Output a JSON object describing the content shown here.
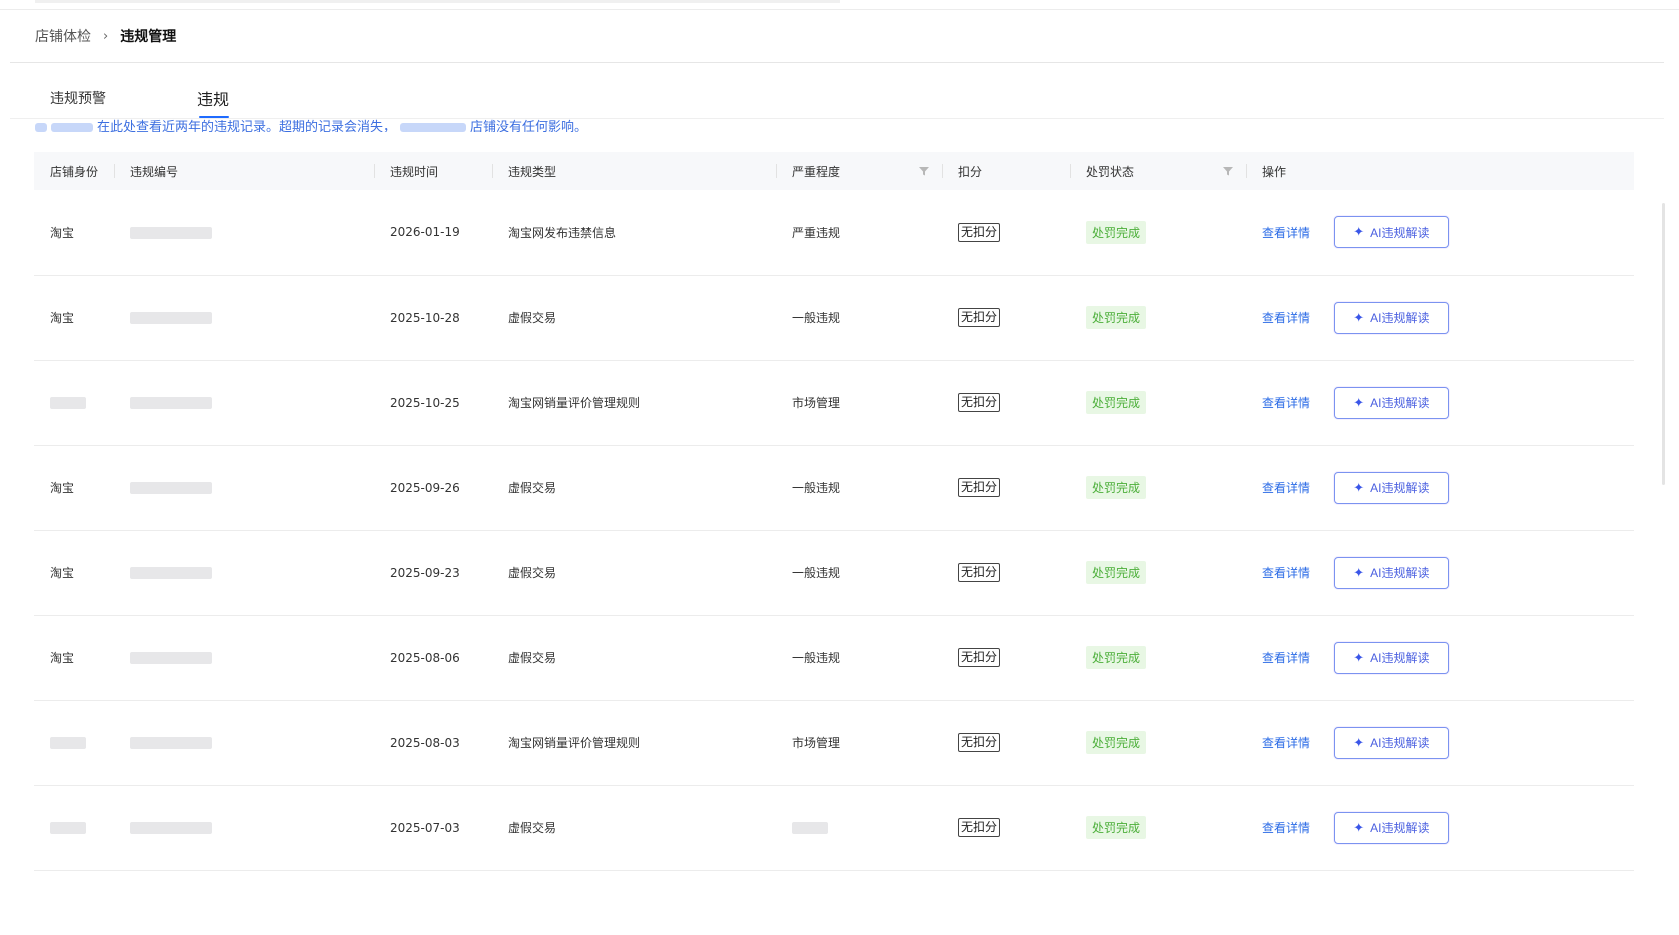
{
  "breadcrumb": {
    "parent": "店铺体检",
    "separator": "›",
    "current": "违规管理"
  },
  "tabs": {
    "warning": "违规预警",
    "violation": "违规"
  },
  "notice": {
    "text_a": "在此处查看近两年的违规记录。超期的记录会消失，",
    "text_b": "店铺没有任何影响。"
  },
  "columns": {
    "shop_identity": "店铺身份",
    "violation_id": "违规编号",
    "violation_time": "违规时间",
    "violation_type": "违规类型",
    "severity": "严重程度",
    "deduction": "扣分",
    "penalty_status": "处罚状态",
    "action": "操作"
  },
  "rows": [
    {
      "shop": "淘宝",
      "id": "",
      "date": "2026-01-19",
      "type": "淘宝网发布违禁信息",
      "severity": "严重违规",
      "deduction": "无扣分",
      "status": "处罚完成",
      "detail": "查看详情",
      "ai": "AI违规解读"
    },
    {
      "shop": "淘宝",
      "id": "",
      "date": "2025-10-28",
      "type": "虚假交易",
      "severity": "一般违规",
      "deduction": "无扣分",
      "status": "处罚完成",
      "detail": "查看详情",
      "ai": "AI违规解读"
    },
    {
      "shop": "",
      "id": "",
      "date": "2025-10-25",
      "type": "淘宝网销量评价管理规则",
      "severity": "市场管理",
      "deduction": "无扣分",
      "status": "处罚完成",
      "detail": "查看详情",
      "ai": "AI违规解读"
    },
    {
      "shop": "淘宝",
      "id": "",
      "date": "2025-09-26",
      "type": "虚假交易",
      "severity": "一般违规",
      "deduction": "无扣分",
      "status": "处罚完成",
      "detail": "查看详情",
      "ai": "AI违规解读"
    },
    {
      "shop": "淘宝",
      "id": "",
      "date": "2025-09-23",
      "type": "虚假交易",
      "severity": "一般违规",
      "deduction": "无扣分",
      "status": "处罚完成",
      "detail": "查看详情",
      "ai": "AI违规解读"
    },
    {
      "shop": "淘宝",
      "id": "",
      "date": "2025-08-06",
      "type": "虚假交易",
      "severity": "一般违规",
      "deduction": "无扣分",
      "status": "处罚完成",
      "detail": "查看详情",
      "ai": "AI违规解读"
    },
    {
      "shop": "",
      "id": "",
      "date": "2025-08-03",
      "type": "淘宝网销量评价管理规则",
      "severity": "市场管理",
      "deduction": "无扣分",
      "status": "处罚完成",
      "detail": "查看详情",
      "ai": "AI违规解读"
    },
    {
      "shop": "",
      "id": "",
      "date": "2025-07-03",
      "type": "虚假交易",
      "severity": "",
      "deduction": "无扣分",
      "status": "处罚完成",
      "detail": "查看详情",
      "ai": "AI违规解读"
    }
  ],
  "colors": {
    "link": "#2b6be6",
    "status_green": "#4caf3a",
    "status_bg": "#e8f7e4",
    "tab_accent": "#1f6bff",
    "ai_border": "#7b93f0"
  },
  "icons": {
    "sort_filter": "filter-icon",
    "ai_button": "sparkle-icon"
  }
}
